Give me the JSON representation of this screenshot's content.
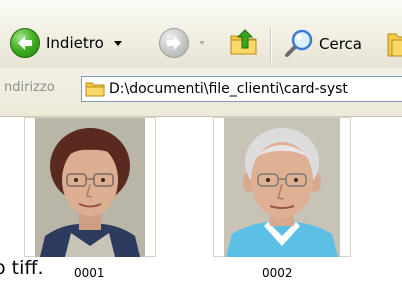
{
  "toolbar": {
    "back_label": "Indietro",
    "search_label": "Cerca",
    "icons": {
      "back": "back-arrow-icon",
      "forward": "forward-arrow-icon",
      "up": "folder-up-icon",
      "search": "search-icon",
      "folders": "folders-icon"
    }
  },
  "address": {
    "label": "ndirizzo",
    "path": "D:\\documenti\\file_clienti\\card-syst"
  },
  "content": {
    "partial_text": "o tiff.",
    "items": [
      {
        "caption": "0001"
      },
      {
        "caption": "0002"
      }
    ]
  },
  "colors": {
    "toolbar_bg": "#ece9d8",
    "back_green": "#3aa61c",
    "address_border": "#7f9db9"
  }
}
